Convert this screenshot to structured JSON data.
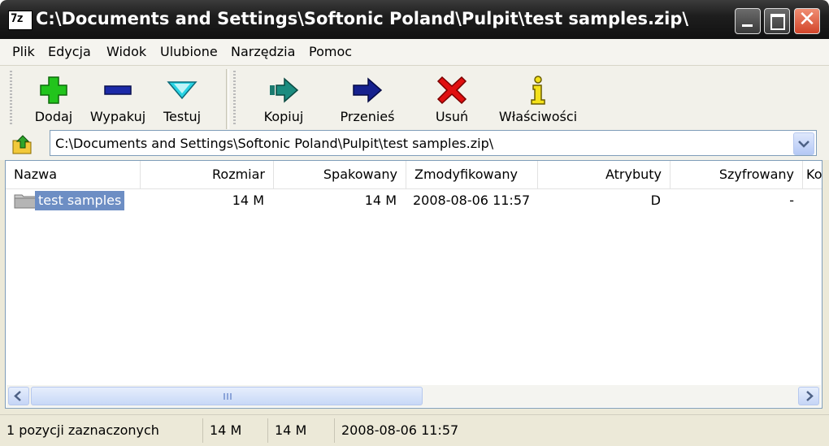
{
  "window": {
    "title": "C:\\Documents and Settings\\Softonic Poland\\Pulpit\\test samples.zip\\",
    "app_icon_text": "7z",
    "close_glyph": "✕"
  },
  "menu": [
    "Plik",
    "Edycja",
    "Widok",
    "Ulubione",
    "Narzędzia",
    "Pomoc"
  ],
  "toolbar": {
    "add": "Dodaj",
    "extract": "Wypakuj",
    "test": "Testuj",
    "copy": "Kopiuj",
    "move": "Przenieś",
    "delete": "Usuń",
    "info": "Właściwości"
  },
  "address": {
    "path": "C:\\Documents and Settings\\Softonic Poland\\Pulpit\\test samples.zip\\"
  },
  "columns": [
    "Nazwa",
    "Rozmiar",
    "Spakowany",
    "Zmodyfikowany",
    "Atrybuty",
    "Szyfrowany",
    "Ko"
  ],
  "rows": [
    {
      "name": "test samples",
      "size": "14 M",
      "packed": "14 M",
      "modified": "2008-08-06 11:57",
      "attributes": "D",
      "encrypted": "-"
    }
  ],
  "status": {
    "selection": "1 pozycji zaznaczonych",
    "size": "14 M",
    "packed": "14 M",
    "modified": "2008-08-06 11:57"
  },
  "colors": {
    "titlebar": "#1e1e1e",
    "selection": "#6d8ec4",
    "add_icon": "#22c41c",
    "delete_icon": "#e01010"
  }
}
